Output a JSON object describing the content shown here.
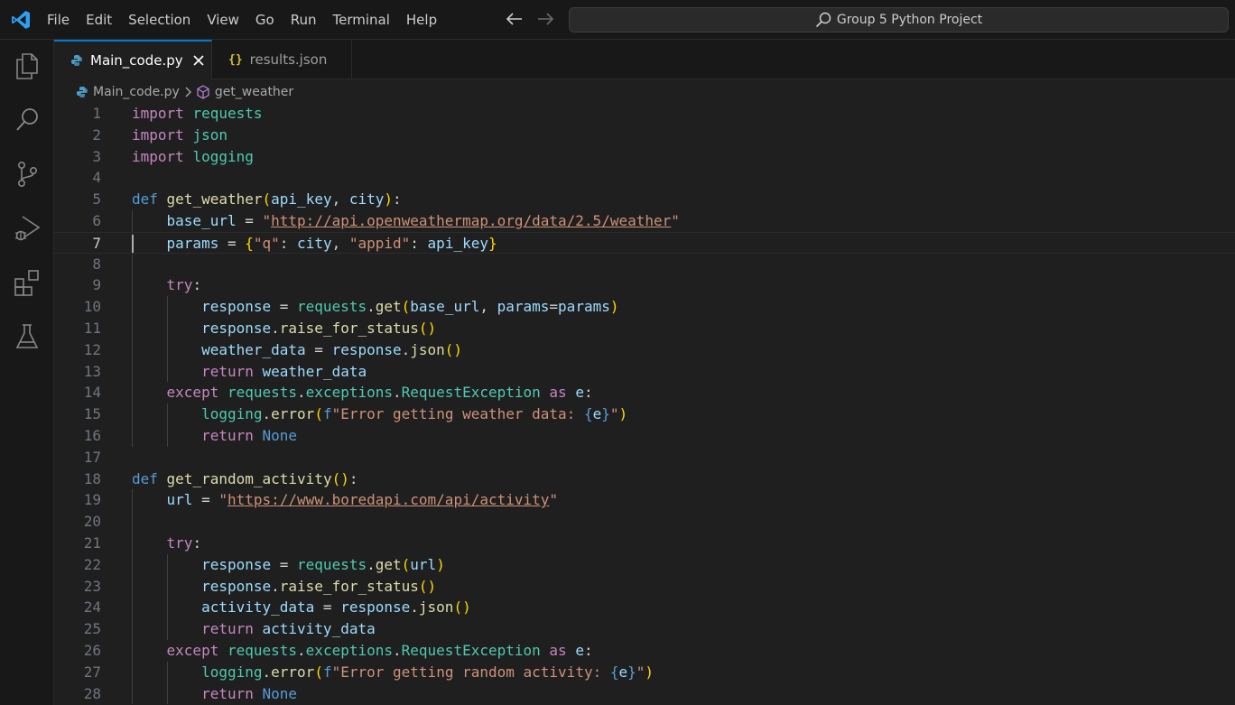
{
  "titlebar": {
    "menu": [
      "File",
      "Edit",
      "Selection",
      "View",
      "Go",
      "Run",
      "Terminal",
      "Help"
    ],
    "search_text": "Group 5 Python Project"
  },
  "activity_bar": [
    "explorer-icon",
    "search-icon",
    "source-control-icon",
    "run-debug-icon",
    "extensions-icon",
    "testing-icon"
  ],
  "tabs": [
    {
      "label": "Main_code.py",
      "icon": "python-file-icon",
      "active": true
    },
    {
      "label": "results.json",
      "icon": "json-file-icon",
      "active": false
    }
  ],
  "breadcrumb": {
    "file": "Main_code.py",
    "symbol": "get_weather"
  },
  "editor": {
    "current_line": 7,
    "lines": [
      [
        [
          "kw",
          "import"
        ],
        [
          "plain",
          " "
        ],
        [
          "mod",
          "requests"
        ]
      ],
      [
        [
          "kw",
          "import"
        ],
        [
          "plain",
          " "
        ],
        [
          "mod",
          "json"
        ]
      ],
      [
        [
          "kw",
          "import"
        ],
        [
          "plain",
          " "
        ],
        [
          "mod",
          "logging"
        ]
      ],
      [],
      [
        [
          "def",
          "def"
        ],
        [
          "plain",
          " "
        ],
        [
          "fn",
          "get_weather"
        ],
        [
          "p1",
          "("
        ],
        [
          "var",
          "api_key"
        ],
        [
          "plain",
          ", "
        ],
        [
          "var",
          "city"
        ],
        [
          "p1",
          ")"
        ],
        [
          "plain",
          ":"
        ]
      ],
      [
        [
          "plain",
          "    "
        ],
        [
          "var",
          "base_url"
        ],
        [
          "plain",
          " = "
        ],
        [
          "str",
          "\""
        ],
        [
          "url",
          "http://api.openweathermap.org/data/2.5/weather"
        ],
        [
          "str",
          "\""
        ]
      ],
      [
        [
          "plain",
          "    "
        ],
        [
          "var",
          "params"
        ],
        [
          "plain",
          " = "
        ],
        [
          "p1",
          "{"
        ],
        [
          "str",
          "\"q\""
        ],
        [
          "plain",
          ": "
        ],
        [
          "var",
          "city"
        ],
        [
          "plain",
          ", "
        ],
        [
          "str",
          "\"appid\""
        ],
        [
          "plain",
          ": "
        ],
        [
          "var",
          "api_key"
        ],
        [
          "p1",
          "}"
        ]
      ],
      [],
      [
        [
          "plain",
          "    "
        ],
        [
          "kw",
          "try"
        ],
        [
          "plain",
          ":"
        ]
      ],
      [
        [
          "plain",
          "        "
        ],
        [
          "var",
          "response"
        ],
        [
          "plain",
          " = "
        ],
        [
          "mod",
          "requests"
        ],
        [
          "plain",
          "."
        ],
        [
          "fn",
          "get"
        ],
        [
          "p1",
          "("
        ],
        [
          "var",
          "base_url"
        ],
        [
          "plain",
          ", "
        ],
        [
          "var",
          "params"
        ],
        [
          "plain",
          "="
        ],
        [
          "var",
          "params"
        ],
        [
          "p1",
          ")"
        ]
      ],
      [
        [
          "plain",
          "        "
        ],
        [
          "var",
          "response"
        ],
        [
          "plain",
          "."
        ],
        [
          "fn",
          "raise_for_status"
        ],
        [
          "p1",
          "()"
        ]
      ],
      [
        [
          "plain",
          "        "
        ],
        [
          "var",
          "weather_data"
        ],
        [
          "plain",
          " = "
        ],
        [
          "var",
          "response"
        ],
        [
          "plain",
          "."
        ],
        [
          "fn",
          "json"
        ],
        [
          "p1",
          "()"
        ]
      ],
      [
        [
          "plain",
          "        "
        ],
        [
          "kw",
          "return"
        ],
        [
          "plain",
          " "
        ],
        [
          "var",
          "weather_data"
        ]
      ],
      [
        [
          "plain",
          "    "
        ],
        [
          "kw",
          "except"
        ],
        [
          "plain",
          " "
        ],
        [
          "mod",
          "requests"
        ],
        [
          "plain",
          "."
        ],
        [
          "mod",
          "exceptions"
        ],
        [
          "plain",
          "."
        ],
        [
          "mod",
          "RequestException"
        ],
        [
          "plain",
          " "
        ],
        [
          "kw",
          "as"
        ],
        [
          "plain",
          " "
        ],
        [
          "var",
          "e"
        ],
        [
          "plain",
          ":"
        ]
      ],
      [
        [
          "plain",
          "        "
        ],
        [
          "mod",
          "logging"
        ],
        [
          "plain",
          "."
        ],
        [
          "fn",
          "error"
        ],
        [
          "p1",
          "("
        ],
        [
          "def",
          "f"
        ],
        [
          "str",
          "\"Error getting weather data: "
        ],
        [
          "def",
          "{"
        ],
        [
          "var",
          "e"
        ],
        [
          "def",
          "}"
        ],
        [
          "str",
          "\""
        ],
        [
          "p1",
          ")"
        ]
      ],
      [
        [
          "plain",
          "        "
        ],
        [
          "kw",
          "return"
        ],
        [
          "plain",
          " "
        ],
        [
          "const",
          "None"
        ]
      ],
      [],
      [
        [
          "def",
          "def"
        ],
        [
          "plain",
          " "
        ],
        [
          "fn",
          "get_random_activity"
        ],
        [
          "p1",
          "()"
        ],
        [
          "plain",
          ":"
        ]
      ],
      [
        [
          "plain",
          "    "
        ],
        [
          "var",
          "url"
        ],
        [
          "plain",
          " = "
        ],
        [
          "str",
          "\""
        ],
        [
          "url",
          "https://www.boredapi.com/api/activity"
        ],
        [
          "str",
          "\""
        ]
      ],
      [],
      [
        [
          "plain",
          "    "
        ],
        [
          "kw",
          "try"
        ],
        [
          "plain",
          ":"
        ]
      ],
      [
        [
          "plain",
          "        "
        ],
        [
          "var",
          "response"
        ],
        [
          "plain",
          " = "
        ],
        [
          "mod",
          "requests"
        ],
        [
          "plain",
          "."
        ],
        [
          "fn",
          "get"
        ],
        [
          "p1",
          "("
        ],
        [
          "var",
          "url"
        ],
        [
          "p1",
          ")"
        ]
      ],
      [
        [
          "plain",
          "        "
        ],
        [
          "var",
          "response"
        ],
        [
          "plain",
          "."
        ],
        [
          "fn",
          "raise_for_status"
        ],
        [
          "p1",
          "()"
        ]
      ],
      [
        [
          "plain",
          "        "
        ],
        [
          "var",
          "activity_data"
        ],
        [
          "plain",
          " = "
        ],
        [
          "var",
          "response"
        ],
        [
          "plain",
          "."
        ],
        [
          "fn",
          "json"
        ],
        [
          "p1",
          "()"
        ]
      ],
      [
        [
          "plain",
          "        "
        ],
        [
          "kw",
          "return"
        ],
        [
          "plain",
          " "
        ],
        [
          "var",
          "activity_data"
        ]
      ],
      [
        [
          "plain",
          "    "
        ],
        [
          "kw",
          "except"
        ],
        [
          "plain",
          " "
        ],
        [
          "mod",
          "requests"
        ],
        [
          "plain",
          "."
        ],
        [
          "mod",
          "exceptions"
        ],
        [
          "plain",
          "."
        ],
        [
          "mod",
          "RequestException"
        ],
        [
          "plain",
          " "
        ],
        [
          "kw",
          "as"
        ],
        [
          "plain",
          " "
        ],
        [
          "var",
          "e"
        ],
        [
          "plain",
          ":"
        ]
      ],
      [
        [
          "plain",
          "        "
        ],
        [
          "mod",
          "logging"
        ],
        [
          "plain",
          "."
        ],
        [
          "fn",
          "error"
        ],
        [
          "p1",
          "("
        ],
        [
          "def",
          "f"
        ],
        [
          "str",
          "\"Error getting random activity: "
        ],
        [
          "def",
          "{"
        ],
        [
          "var",
          "e"
        ],
        [
          "def",
          "}"
        ],
        [
          "str",
          "\""
        ],
        [
          "p1",
          ")"
        ]
      ],
      [
        [
          "plain",
          "        "
        ],
        [
          "kw",
          "return"
        ],
        [
          "plain",
          " "
        ],
        [
          "const",
          "None"
        ]
      ]
    ]
  }
}
